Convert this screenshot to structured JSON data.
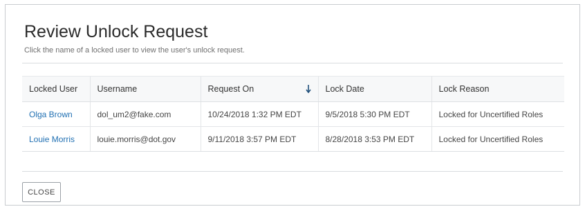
{
  "dialog": {
    "title": "Review Unlock Request",
    "subtitle": "Click the name of a locked user to view the user's unlock request."
  },
  "table": {
    "columns": [
      "Locked User",
      "Username",
      "Request On",
      "Lock Date",
      "Lock Reason"
    ],
    "sort_icon": "arrow-down-icon",
    "rows": [
      {
        "locked_user": "Olga Brown",
        "username": "dol_um2@fake.com",
        "request_on": "10/24/2018 1:32 PM EDT",
        "lock_date": "9/5/2018 5:30 PM EDT",
        "lock_reason": "Locked for Uncertified Roles"
      },
      {
        "locked_user": "Louie Morris",
        "username": "louie.morris@dot.gov",
        "request_on": "9/11/2018 3:57 PM EDT",
        "lock_date": "8/28/2018 3:53 PM EDT",
        "lock_reason": "Locked for Uncertified Roles"
      }
    ]
  },
  "footer": {
    "close_label": "CLOSE"
  },
  "colors": {
    "link": "#1f6fb2",
    "header_bg": "#f7f8f9",
    "border": "#c9ccd0"
  }
}
